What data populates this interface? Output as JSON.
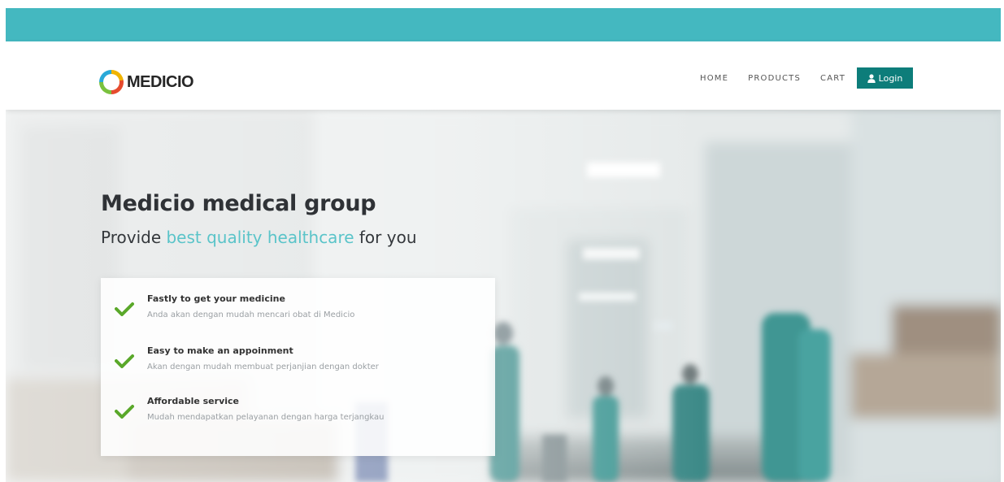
{
  "brand": {
    "name": "MEDICIO",
    "colors": {
      "topbar": "#44b8c0",
      "accent": "#5ac4c9",
      "login_button": "#0d7d7a",
      "check": "#5aa82a"
    }
  },
  "nav": {
    "items": [
      {
        "label": "HOME"
      },
      {
        "label": "PRODUCTS"
      },
      {
        "label": "CART"
      }
    ],
    "login": {
      "label": "Login",
      "icon": "user-icon"
    }
  },
  "hero": {
    "title": "Medicio medical group",
    "subtitle_pre": "Provide ",
    "subtitle_accent": "best quality healthcare",
    "subtitle_post": " for you",
    "features": [
      {
        "icon": "check-icon",
        "title": "Fastly to get your medicine",
        "desc": "Anda akan dengan mudah mencari obat di Medicio"
      },
      {
        "icon": "check-icon",
        "title": "Easy to make an appoinment",
        "desc": "Akan dengan mudah membuat perjanjian dengan dokter"
      },
      {
        "icon": "check-icon",
        "title": "Affordable service",
        "desc": "Mudah mendapatkan pelayanan dengan harga terjangkau"
      }
    ]
  }
}
